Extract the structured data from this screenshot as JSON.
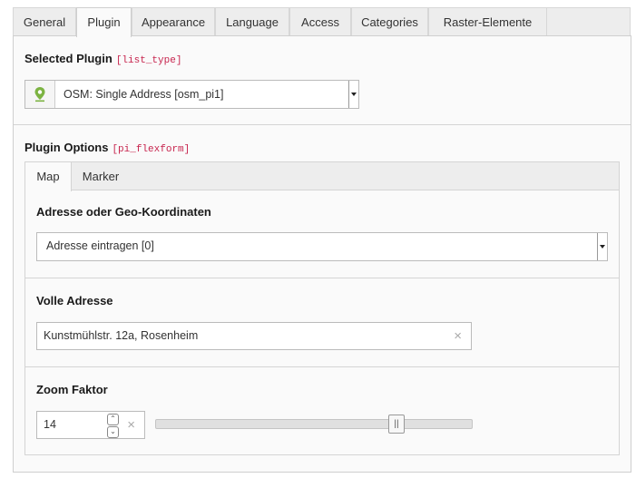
{
  "tabs": [
    {
      "label": "General"
    },
    {
      "label": "Plugin",
      "active": true
    },
    {
      "label": "Appearance"
    },
    {
      "label": "Language"
    },
    {
      "label": "Access"
    },
    {
      "label": "Categories"
    },
    {
      "label": "Raster-Elemente"
    }
  ],
  "selected_plugin": {
    "label": "Selected Plugin",
    "code": "[list_type]",
    "value": "OSM: Single Address [osm_pi1]",
    "icon": "map-pin-icon"
  },
  "plugin_options": {
    "label": "Plugin Options",
    "code": "[pi_flexform]",
    "tabs": [
      {
        "label": "Map",
        "active": true
      },
      {
        "label": "Marker"
      }
    ],
    "fields": {
      "address_mode": {
        "label": "Adresse oder Geo-Koordinaten",
        "value": "Adresse eintragen [0]"
      },
      "full_address": {
        "label": "Volle Adresse",
        "value": "Kunstmühlstr. 12a, Rosenheim"
      },
      "zoom": {
        "label": "Zoom Faktor",
        "value": "14",
        "slider_fraction": 0.76
      }
    }
  },
  "colors": {
    "accent": "#c7254e",
    "pin_green": "#7cb342"
  }
}
